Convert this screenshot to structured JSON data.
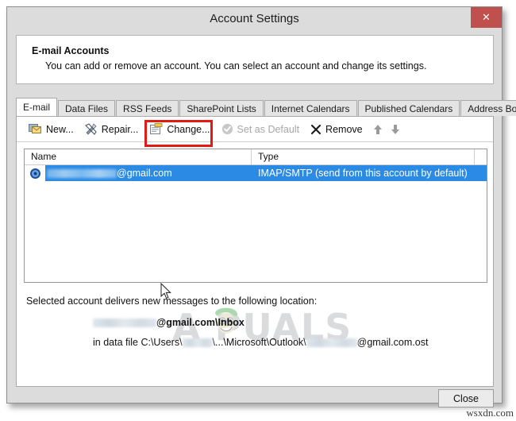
{
  "window": {
    "title": "Account Settings",
    "close_icon": "close-x-icon",
    "close_label": "✕"
  },
  "header": {
    "title": "E-mail Accounts",
    "description": "You can add or remove an account. You can select an account and change its settings."
  },
  "tabs": [
    {
      "label": "E-mail",
      "active": true
    },
    {
      "label": "Data Files",
      "active": false
    },
    {
      "label": "RSS Feeds",
      "active": false
    },
    {
      "label": "SharePoint Lists",
      "active": false
    },
    {
      "label": "Internet Calendars",
      "active": false
    },
    {
      "label": "Published Calendars",
      "active": false
    },
    {
      "label": "Address Books",
      "active": false
    }
  ],
  "toolbar": {
    "new_label": "New...",
    "repair_label": "Repair...",
    "change_label": "Change...",
    "set_default_label": "Set as Default",
    "remove_label": "Remove",
    "move_up_label": "↑",
    "move_down_label": "↓",
    "highlight_color": "#e01b16"
  },
  "list": {
    "columns": [
      "Name",
      "Type"
    ],
    "rows": [
      {
        "name_suffix": "@gmail.com",
        "name_redacted": true,
        "type": "IMAP/SMTP (send from this account by default)",
        "selected": true,
        "selection_color": "#2a8ae4"
      }
    ]
  },
  "details": {
    "intro": "Selected account delivers new messages to the following location:",
    "location_suffix": "@gmail.com\\Inbox",
    "datafile_prefix": "in data file C:\\Users\\",
    "datafile_middle": "\\...\\Microsoft\\Outlook\\",
    "datafile_suffix": "@gmail.com.ost"
  },
  "footer": {
    "close_label": "Close"
  },
  "watermark": {
    "brand": "A  PUALS",
    "site": "wsxdn.com"
  }
}
